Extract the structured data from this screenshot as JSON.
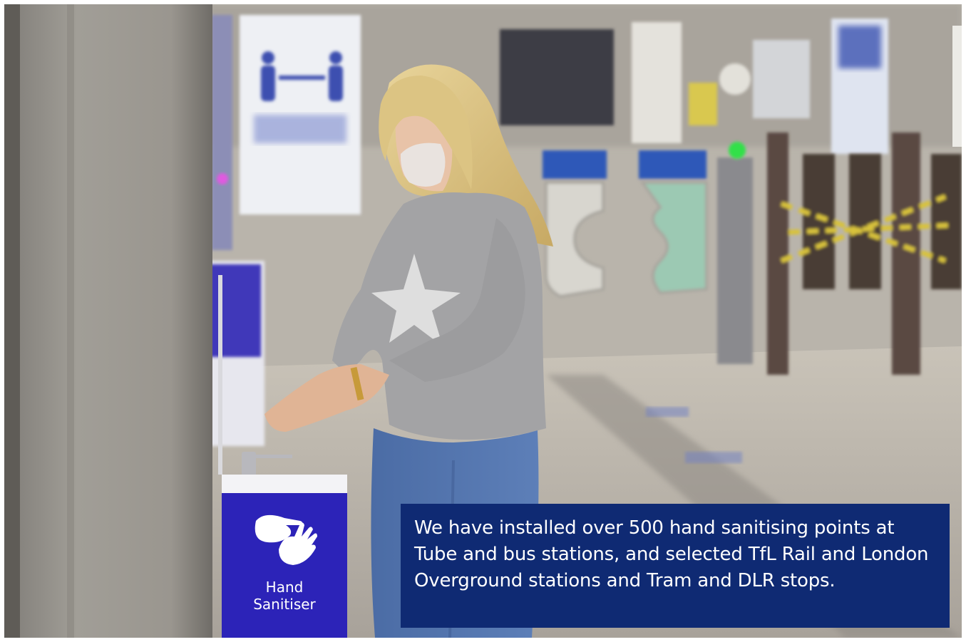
{
  "photo": {
    "description_icons": [
      "hand-sanitiser-station",
      "hand-washing-icon",
      "social-distance-poster",
      "ticket-barriers"
    ],
    "station_sign": {
      "line1": "Hand",
      "line2": "Sanitiser"
    },
    "colors": {
      "caption_background": "#0f2a73",
      "caption_text": "#ffffff",
      "sanitiser_blue": "#2c23b8"
    }
  },
  "caption": {
    "text": "We have installed over 500 hand sanitising points at Tube and bus stations, and selected TfL Rail and London Overground stations and Tram and DLR stops."
  }
}
